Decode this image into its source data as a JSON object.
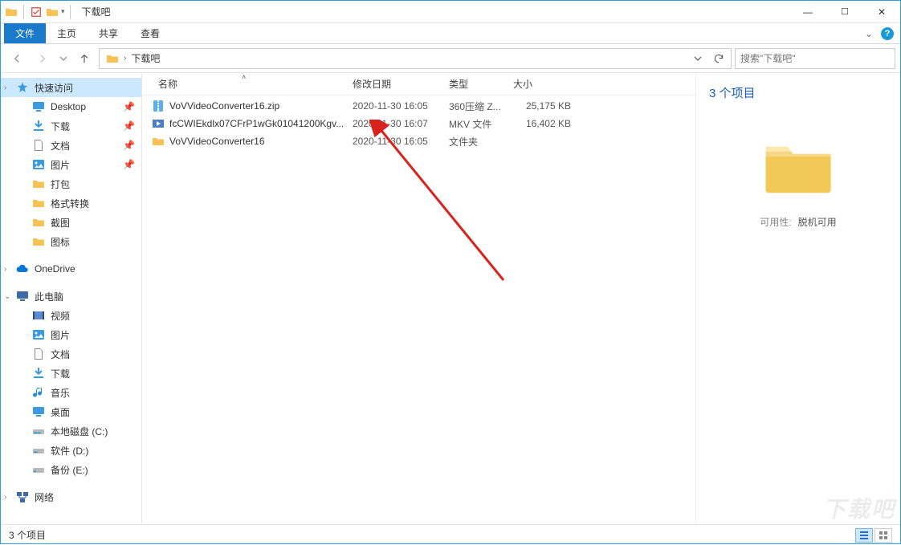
{
  "window": {
    "title": "下载吧",
    "minimize_glyph": "—",
    "maximize_glyph": "☐",
    "close_glyph": "✕"
  },
  "ribbon": {
    "file": "文件",
    "tabs": [
      "主页",
      "共享",
      "查看"
    ]
  },
  "nav": {
    "crumb": "下载吧",
    "search_placeholder": "搜索\"下载吧\""
  },
  "sidebar": {
    "quick": "快速访问",
    "quick_items": [
      "Desktop",
      "下载",
      "文档",
      "图片",
      "打包",
      "格式转换",
      "截图",
      "图标"
    ],
    "onedrive": "OneDrive",
    "thispc": "此电脑",
    "pc_items": [
      "视频",
      "图片",
      "文档",
      "下载",
      "音乐",
      "桌面",
      "本地磁盘 (C:)",
      "软件 (D:)",
      "备份 (E:)"
    ],
    "network": "网络"
  },
  "columns": {
    "name": "名称",
    "date": "修改日期",
    "type": "类型",
    "size": "大小"
  },
  "files": [
    {
      "icon": "zip",
      "name": "VoVVideoConverter16.zip",
      "date": "2020-11-30 16:05",
      "type": "360压缩 Z...",
      "size": "25,175 KB"
    },
    {
      "icon": "video",
      "name": "fcCWIEkdlx07CFrP1wGk01041200Kgv...",
      "date": "2020-11-30 16:07",
      "type": "MKV 文件",
      "size": "16,402 KB"
    },
    {
      "icon": "folder",
      "name": "VoVVideoConverter16",
      "date": "2020-11-30 16:05",
      "type": "文件夹",
      "size": ""
    }
  ],
  "details": {
    "title": "3 个项目",
    "avail_label": "可用性:",
    "avail_value": "脱机可用"
  },
  "status": {
    "text": "3 个项目"
  },
  "watermark": "下载吧"
}
